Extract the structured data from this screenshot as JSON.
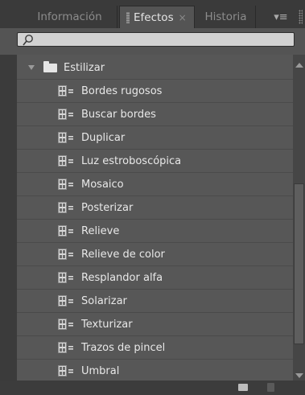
{
  "tabs": {
    "info": "Información",
    "effects": "Efectos",
    "history": "Historia",
    "close": "×",
    "menu": "▾≡"
  },
  "search": {
    "value": "",
    "placeholder": ""
  },
  "tree": {
    "folder": "Estilizar",
    "items": [
      "Bordes rugosos",
      "Buscar bordes",
      "Duplicar",
      "Luz estroboscópica",
      "Mosaico",
      "Posterizar",
      "Relieve",
      "Relieve de color",
      "Resplandor alfa",
      "Solarizar",
      "Texturizar",
      "Trazos de pincel",
      "Umbral"
    ]
  },
  "colors": {
    "panel": "#575757",
    "text": "#e8e8e8",
    "tab_active": "#545454",
    "search_field": "#d2d2d2"
  }
}
